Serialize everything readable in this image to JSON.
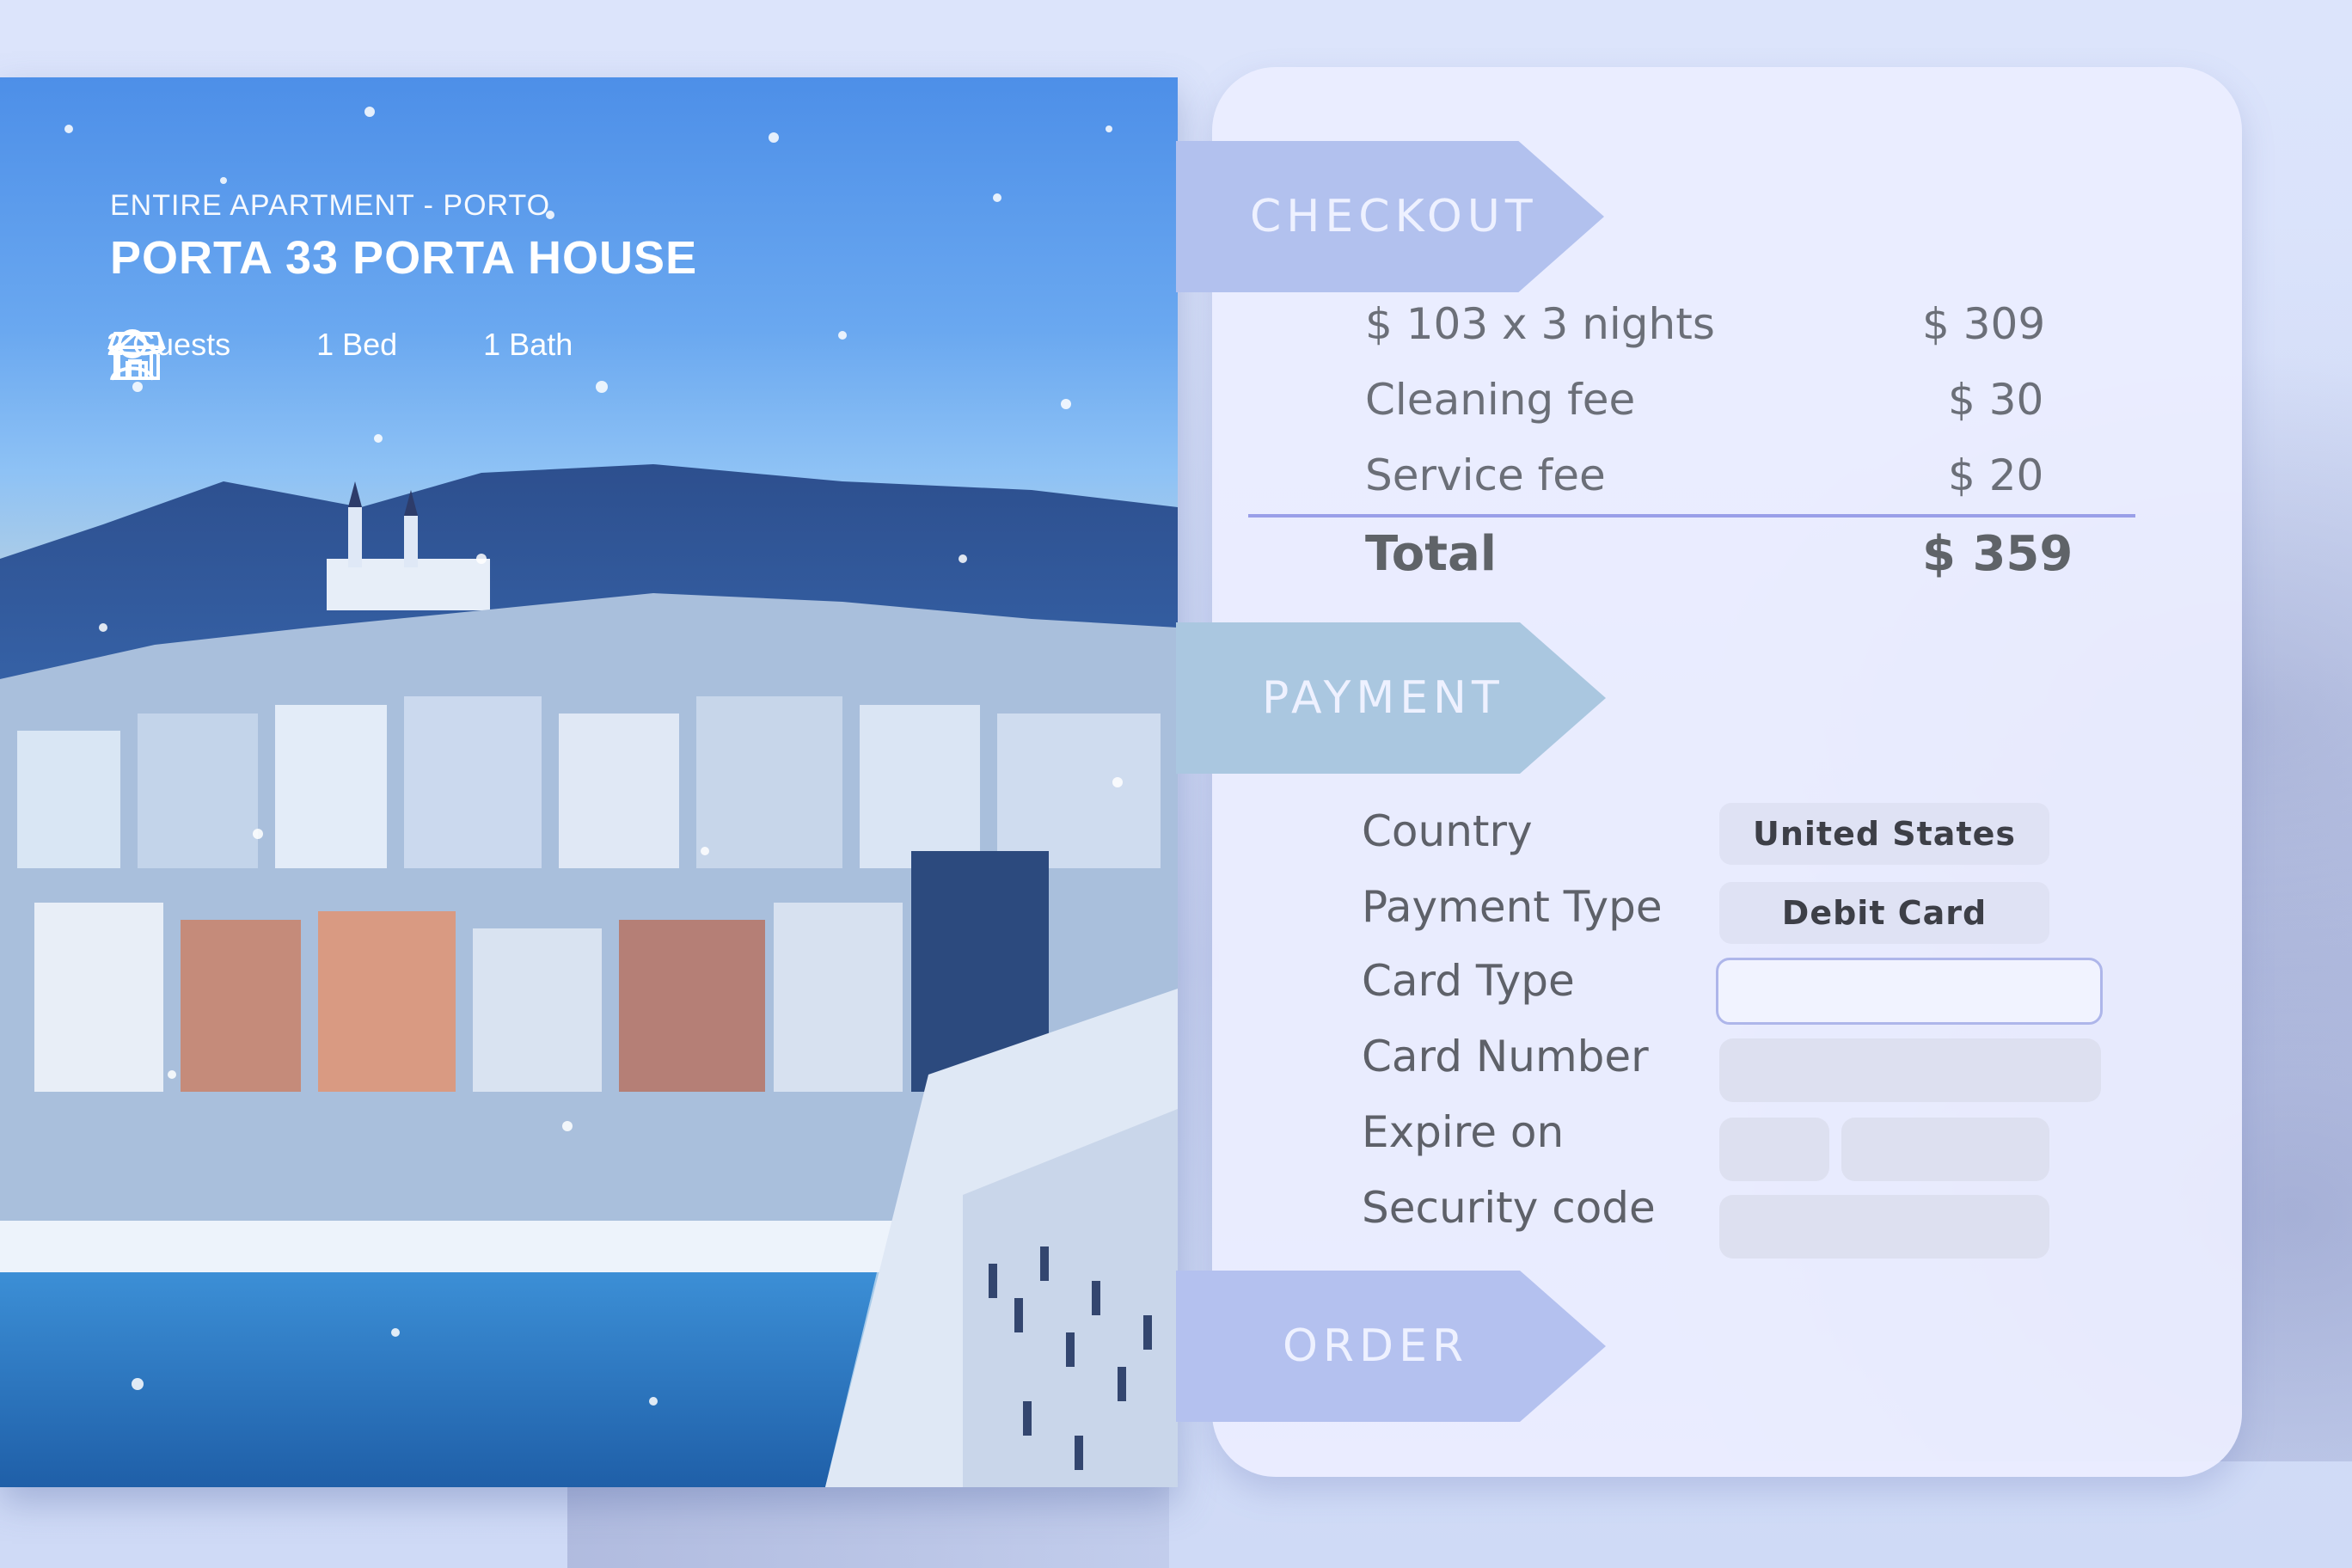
{
  "listing": {
    "kicker": "ENTIRE APARTMENT - PORTO",
    "title": "PORTA 33 PORTA HOUSE",
    "amenities": [
      {
        "icon": "user-icon",
        "label": "2 Guests"
      },
      {
        "icon": "house-icon",
        "label": "1 Bed"
      },
      {
        "icon": "bath-icon",
        "label": "1 Bath"
      }
    ]
  },
  "checkout": {
    "heading": "CHECKOUT",
    "lines": [
      {
        "label": "$ 103  x 3 nights",
        "amount": "$ 309"
      },
      {
        "label": "Cleaning fee",
        "amount": "$ 30"
      },
      {
        "label": "Service fee",
        "amount": "$ 20"
      }
    ],
    "total_label": "Total",
    "total_amount": "$ 359"
  },
  "payment": {
    "heading": "PAYMENT",
    "fields": [
      {
        "label": "Country",
        "value": "United States"
      },
      {
        "label": "Payment Type",
        "value": "Debit Card"
      },
      {
        "label": "Card Type",
        "value": ""
      },
      {
        "label": "Card Number",
        "value": ""
      },
      {
        "label": "Expire on",
        "value": ""
      },
      {
        "label": "Security code",
        "value": ""
      }
    ]
  },
  "order": {
    "heading": "ORDER"
  },
  "colors": {
    "panel": "#eceeff",
    "checkout_banner": "#b2c1ee",
    "payment_banner": "#aac7e0",
    "order_banner": "#b4c1ef",
    "total_rule": "#9a9fe8"
  }
}
